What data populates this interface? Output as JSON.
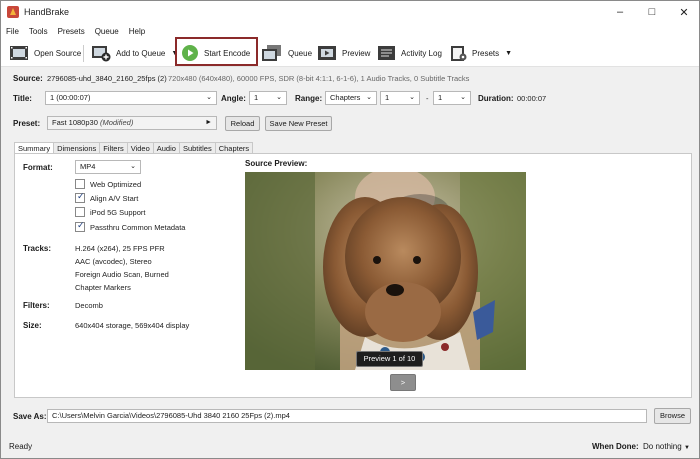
{
  "window": {
    "title": "HandBrake"
  },
  "menu": [
    "File",
    "Tools",
    "Presets",
    "Queue",
    "Help"
  ],
  "toolbar": {
    "open_source": "Open Source",
    "add_to_queue": "Add to Queue",
    "start_encode": "Start Encode",
    "queue": "Queue",
    "preview": "Preview",
    "activity_log": "Activity Log",
    "presets": "Presets"
  },
  "source": {
    "label": "Source:",
    "name": "2796085-uhd_3840_2160_25fps (2)",
    "info": "720x480 (640x480), 60000 FPS, SDR (8-bit 4:1:1, 6-1-6), 1 Audio Tracks, 0 Subtitle Tracks"
  },
  "title_row": {
    "title_label": "Title:",
    "title_value": "1 (00:00:07)",
    "angle_label": "Angle:",
    "angle_value": "1",
    "range_label": "Range:",
    "range_value": "Chapters",
    "range_from": "1",
    "range_sep": "-",
    "range_to": "1",
    "duration_label": "Duration:",
    "duration_value": "00:00:07"
  },
  "preset": {
    "label": "Preset:",
    "value": "Fast 1080p30",
    "modified": "(Modified)",
    "reload": "Reload",
    "save_new": "Save New Preset"
  },
  "tabs": [
    "Summary",
    "Dimensions",
    "Filters",
    "Video",
    "Audio",
    "Subtitles",
    "Chapters"
  ],
  "summary": {
    "format_label": "Format:",
    "format_value": "MP4",
    "options": [
      {
        "label": "Web Optimized",
        "checked": false
      },
      {
        "label": "Align A/V Start",
        "checked": true
      },
      {
        "label": "iPod 5G Support",
        "checked": false
      },
      {
        "label": "Passthru Common Metadata",
        "checked": true
      }
    ],
    "tracks_label": "Tracks:",
    "tracks": [
      "H.264 (x264), 25 FPS PFR",
      "AAC (avcodec), Stereo",
      "Foreign Audio Scan, Burned",
      "Chapter Markers"
    ],
    "filters_label": "Filters:",
    "filters_value": "Decomb",
    "size_label": "Size:",
    "size_value": "640x404 storage, 569x404 display",
    "source_preview_label": "Source Preview:",
    "preview_counter": "Preview 1 of 10",
    "next": ">"
  },
  "save": {
    "label": "Save As:",
    "path": "C:\\Users\\Melvin Garcia\\Videos\\2796085-Uhd 3840 2160 25Fps (2).mp4",
    "browse": "Browse"
  },
  "status": {
    "text": "Ready",
    "when_done_label": "When Done:",
    "when_done_value": "Do nothing"
  }
}
